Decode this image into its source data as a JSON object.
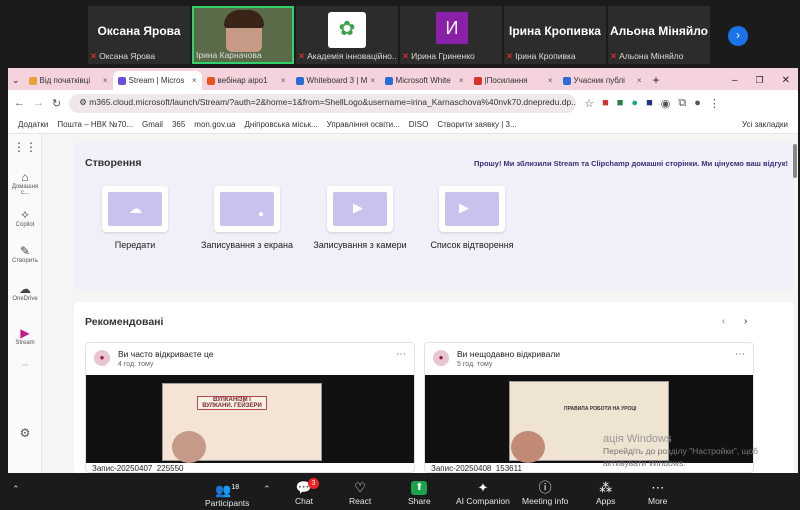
{
  "participants": [
    {
      "name": "Оксана Ярова",
      "caption": "Оксана Ярова",
      "type": "name"
    },
    {
      "name": "",
      "caption": "Ірина Карначова",
      "type": "video"
    },
    {
      "name": "",
      "caption": "Академія інноваційно...",
      "type": "logo"
    },
    {
      "name": "И",
      "caption": "Ирина Гриненко",
      "type": "initial"
    },
    {
      "name": "Ірина Кропивка",
      "caption": "Ірина Кропивка",
      "type": "name"
    },
    {
      "name": "Альона Міняйло",
      "caption": "Альона Міняйло",
      "type": "name"
    }
  ],
  "browser": {
    "tabs": [
      {
        "label": "Від початківці",
        "color": "#e8a23a"
      },
      {
        "label": "Stream | Micros",
        "color": "#6b4fd8",
        "active": true
      },
      {
        "label": "вебінар аіро1",
        "color": "#e8521f"
      },
      {
        "label": "Whiteboard 3 | M",
        "color": "#2a6bd8"
      },
      {
        "label": "Microsoft White",
        "color": "#2a6bd8"
      },
      {
        "label": "|Посилання",
        "color": "#d8322a"
      },
      {
        "label": "Учасник публі",
        "color": "#2a6bd8"
      }
    ],
    "url": "m365.cloud.microsoft/launch/Stream/?auth=2&home=1&from=ShellLogo&username=irina_Karnaschova%40nvk70.dnepredu.dp....",
    "bookmarks": [
      "Додатки",
      "Пошта – НВК №70...",
      "Gmail",
      "365",
      "mon.gov.ua",
      "Дніпровська міськ...",
      "Управління освіти...",
      "DISO",
      "Створити заявку | 3..."
    ],
    "all_bookmarks": "Усі закладки"
  },
  "rail": [
    {
      "label": "",
      "icon": "apps-icon"
    },
    {
      "label": "Домашня с...",
      "icon": "home-icon"
    },
    {
      "label": "Copilot",
      "icon": "copilot-icon"
    },
    {
      "label": "Створить",
      "icon": "create-icon"
    },
    {
      "label": "OneDrive",
      "icon": "cloud-icon"
    },
    {
      "label": "Stream",
      "icon": "stream-icon"
    }
  ],
  "create": {
    "title": "Створення",
    "promo": "Прошу! Ми зблизили Stream та Clipchamp домашні сторінки. Ми цінуємо ваш відгук!",
    "cards": [
      "Передати",
      "Записування з екрана",
      "Записування з камери",
      "Список відтворення"
    ]
  },
  "recs": {
    "title": "Рекомендовані",
    "items": [
      {
        "heading": "Ви часто відкриваєте це",
        "time": "4 год. тому",
        "file": "Запис-20250407_225550",
        "slide_text": "ВУЛКАНІЗМ І ВУЛКАНИ. ГЕЙЗЕРИ"
      },
      {
        "heading": "Ви нещодавно відкривали",
        "time": "5 год. тому",
        "file": "Запис-20250408_153611",
        "slide_text": "ПРАВИЛА РОБОТИ НА УРОЦІ"
      }
    ]
  },
  "activation": {
    "line1": "ація Windows",
    "line2": "Перейдіть до розділу \"Настройки\", щоб",
    "line3": "активувати Windows."
  },
  "toolbar": {
    "participants_count": "18",
    "chat_badge": "3",
    "items": [
      "Participants",
      "Chat",
      "React",
      "Share",
      "AI Companion",
      "Meeting info",
      "Apps",
      "More"
    ]
  }
}
